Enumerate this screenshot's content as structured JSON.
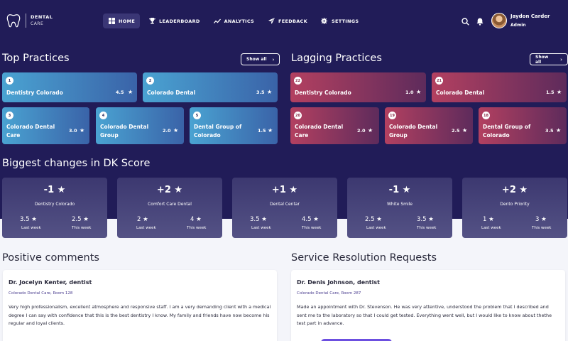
{
  "app": {
    "logo_line1": "DENTAL",
    "logo_line2": "CARE"
  },
  "nav": [
    {
      "label": "HOME",
      "icon": "grid-icon",
      "active": true
    },
    {
      "label": "LEADERBOARD",
      "icon": "trophy-icon"
    },
    {
      "label": "ANALYTICS",
      "icon": "line-chart-icon"
    },
    {
      "label": "FEEDBACK",
      "icon": "send-icon"
    },
    {
      "label": "SETTINGS",
      "icon": "gear-icon"
    }
  ],
  "user": {
    "name": "Jaydon Carder",
    "role": "Admin"
  },
  "top": {
    "title": "Top Practices",
    "show_all": "Show all",
    "cards": [
      {
        "rank": "1",
        "name": "Dentistry Colorado",
        "score": "4.5"
      },
      {
        "rank": "2",
        "name": "Colorado Dental",
        "score": "3.5"
      },
      {
        "rank": "3",
        "name": "Colorado Dental Care",
        "score": "3.0"
      },
      {
        "rank": "4",
        "name": "Colorado Dental Group",
        "score": "2.0"
      },
      {
        "rank": "5",
        "name": "Dental Group of Colorado",
        "score": "1.5"
      }
    ]
  },
  "lagging": {
    "title": "Lagging Practices",
    "show_all": "Show all",
    "cards": [
      {
        "rank": "22",
        "name": "Dentistry Colorado",
        "score": "1.0"
      },
      {
        "rank": "21",
        "name": "Colorado Dental",
        "score": "1.5"
      },
      {
        "rank": "20",
        "name": "Colorado Dental Care",
        "score": "2.0"
      },
      {
        "rank": "19",
        "name": "Colorado Dental Group",
        "score": "2.5"
      },
      {
        "rank": "18",
        "name": "Dental Group of Colorado",
        "score": "3.5"
      }
    ]
  },
  "dk": {
    "title": "Biggest changes in DK Score",
    "last_label": "Last week",
    "this_label": "This week",
    "cards": [
      {
        "change": "-1",
        "name": "Dentistry Colorado",
        "last": "3.5",
        "this": "2.5"
      },
      {
        "change": "+2",
        "name": "Comfort Care Dental",
        "last": "2",
        "this": "4"
      },
      {
        "change": "+1",
        "name": "Dental Centar",
        "last": "3.5",
        "this": "4.5"
      },
      {
        "change": "-1",
        "name": "White Smile",
        "last": "2.5",
        "this": "3.5"
      },
      {
        "change": "+2",
        "name": "Dento Priority",
        "last": "1",
        "this": "3"
      }
    ]
  },
  "positive": {
    "title": "Positive comments",
    "name": "Dr. Jocelyn Kenter, dentist",
    "location": "Colorado Dental Care, Room 128",
    "text": "Very high professionalism, excellent atmosphere and responsive staff.  I am a very demanding client with a medical degree I can say with confidence that this is the best dentistry I know. My family and friends have now become his regular and loyal clients."
  },
  "service": {
    "title": "Service Resolution Requests",
    "name": "Dr. Denis Johnson, dentist",
    "location": "Colorado Dental Care, Room 287",
    "text": "Made an appointment with Dr. Stevenson. He was very attentive, understood the problem that I described and sent me to the laboratory so that I could get tested. Everything went well, but I would like to know about thethe test part in advance."
  },
  "colors": {
    "hero": "#211c58",
    "top_card": "#4aa3d2",
    "lagging_card": "#b34060",
    "accent": "#6c4fe0"
  }
}
